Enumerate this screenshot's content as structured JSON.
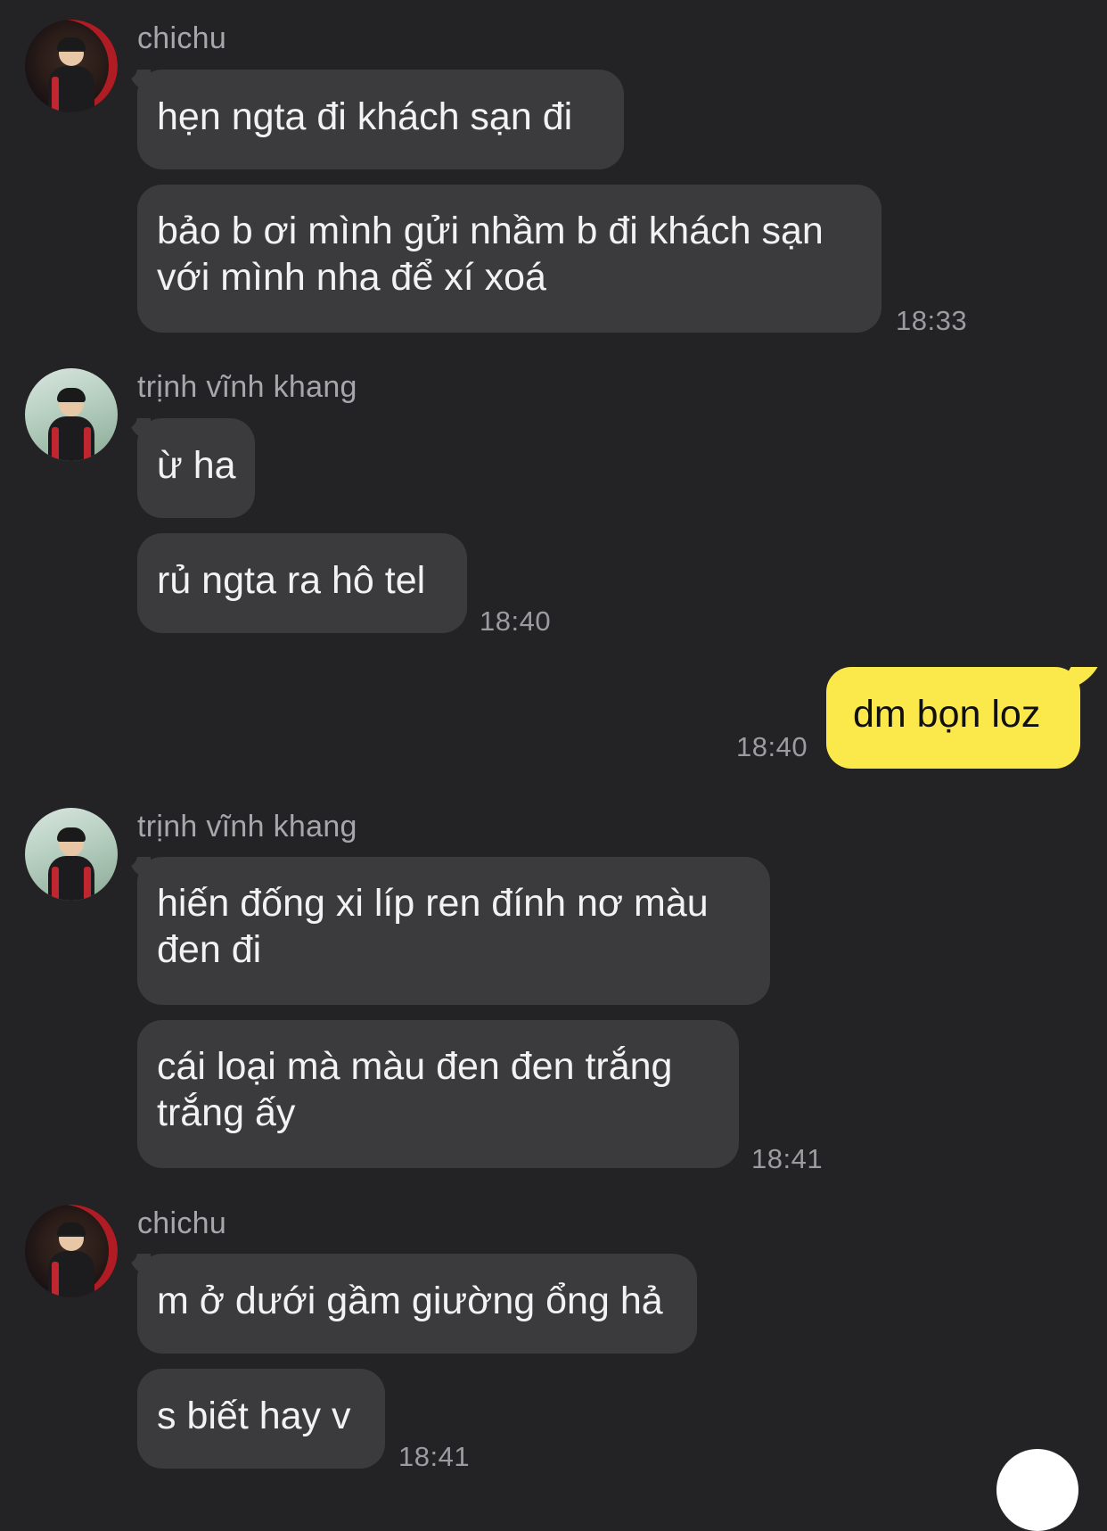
{
  "messages": {
    "g1": {
      "sender": "chichu",
      "m1": "hẹn ngta đi khách sạn đi",
      "m2a": "bảo b ơi mình gửi nhầm b đi khách sạn",
      "m2b": "với mình nha để xí xoá",
      "time": "18:33"
    },
    "g2": {
      "sender": "trịnh vĩnh khang",
      "m1": "ừ ha",
      "m2": "rủ ngta ra hô tel",
      "time": "18:40"
    },
    "g3": {
      "sender": "me",
      "m1": "dm bọn loz",
      "time": "18:40"
    },
    "g4": {
      "sender": "trịnh vĩnh khang",
      "m1a": "hiến đống xi líp ren đính nơ màu",
      "m1b": "đen đi",
      "m2a": "cái loại mà màu đen đen trắng",
      "m2b": "trắng ấy",
      "time": "18:41"
    },
    "g5": {
      "sender": "chichu",
      "m1": "m ở dưới gầm giường ổng hả",
      "m2": "s biết hay v",
      "time": "18:41"
    }
  },
  "colors": {
    "background": "#232325",
    "incoming_bubble": "#3b3b3d",
    "outgoing_bubble": "#fbe84b"
  }
}
